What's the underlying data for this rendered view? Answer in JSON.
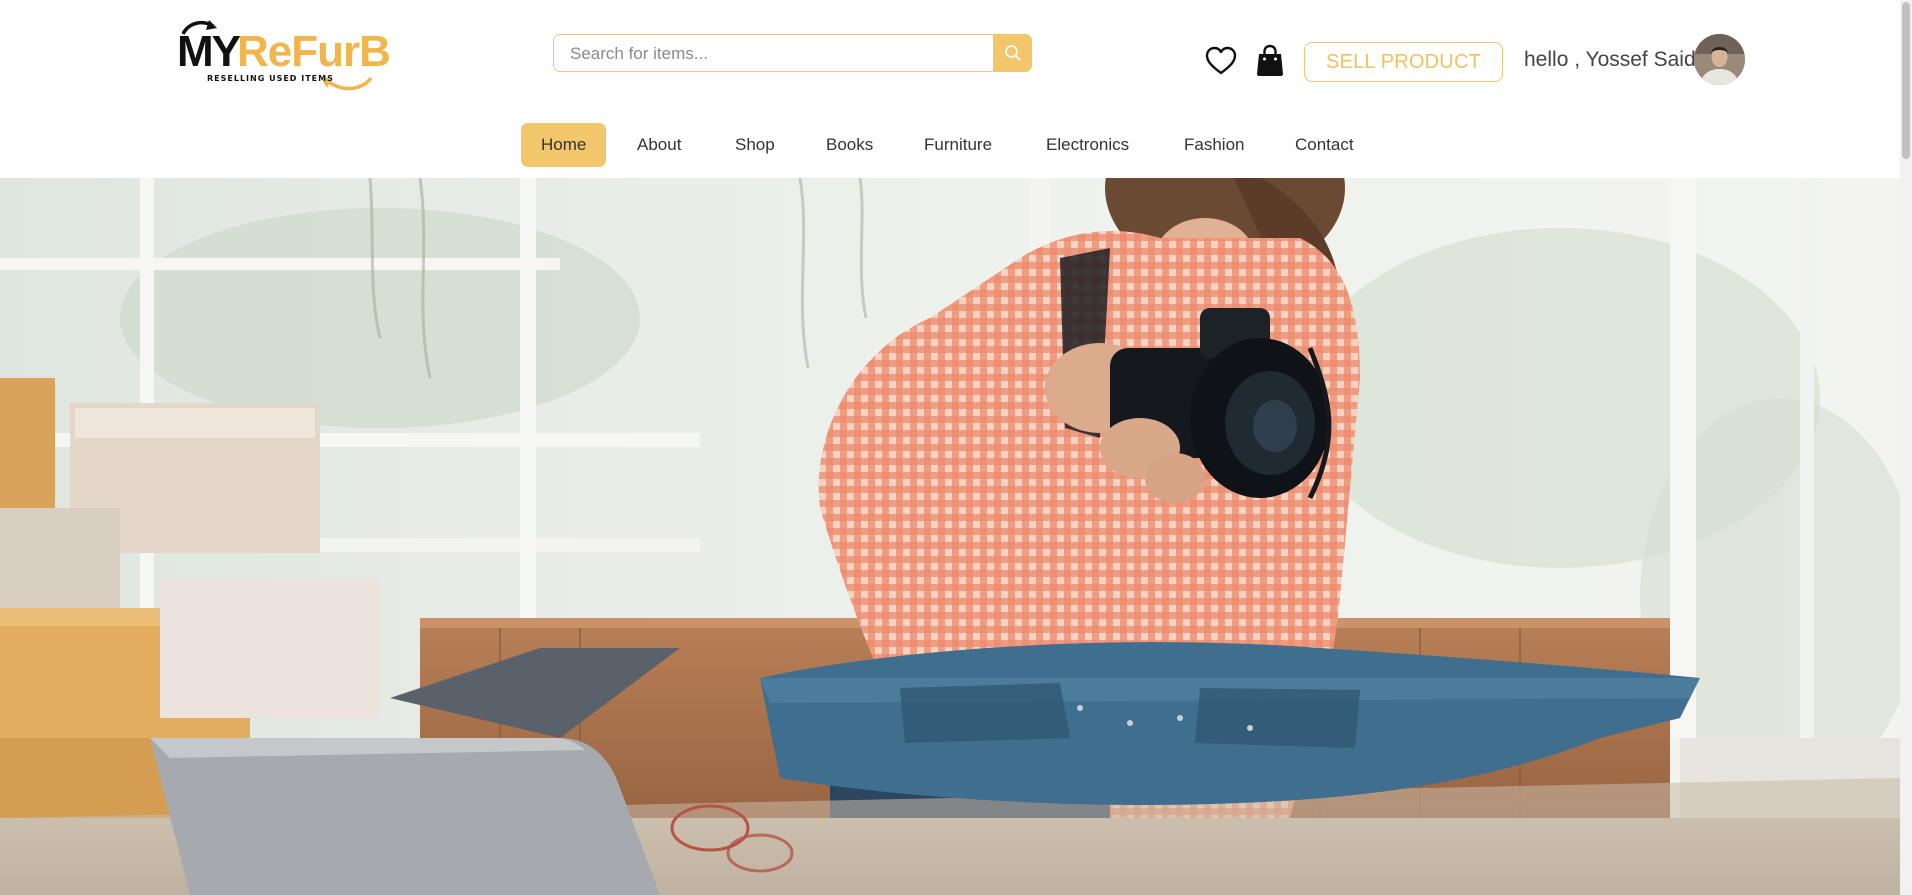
{
  "brand": {
    "logo_main": "MY",
    "logo_accent": "ReFurB",
    "tagline": "RESELLING USED ITEMS",
    "accent_color": "#f2c66b",
    "text_color": "#111111"
  },
  "header": {
    "search": {
      "placeholder": "Search for items...",
      "value": "",
      "icon": "search-icon"
    },
    "wishlist_icon": "heart-icon",
    "cart_icon": "shopping-bag-icon",
    "sell_button": "SELL PRODUCT",
    "greeting": "hello , Yossef Said",
    "avatar_icon": "user-avatar"
  },
  "nav": {
    "items": [
      {
        "label": "Home",
        "active": true
      },
      {
        "label": "About"
      },
      {
        "label": "Shop"
      },
      {
        "label": "Books"
      },
      {
        "label": "Furniture"
      },
      {
        "label": "Electronics"
      },
      {
        "label": "Fashion"
      },
      {
        "label": "Contact"
      }
    ]
  },
  "hero": {
    "image_subject": "woman photographing denim jacket with camera",
    "shirt_color": "#e8795a",
    "denim_color": "#3f6e8e"
  }
}
